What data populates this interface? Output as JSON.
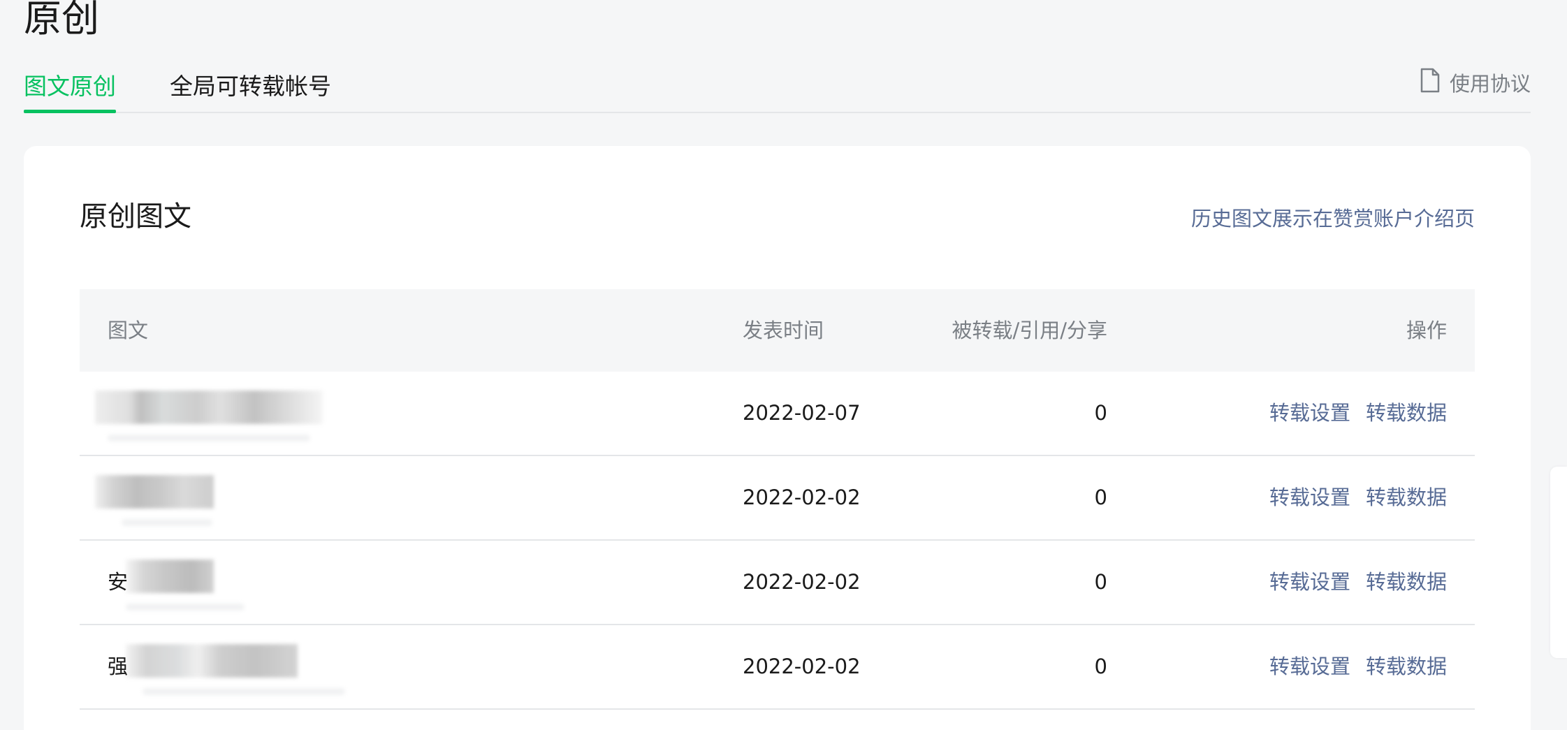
{
  "page": {
    "title": "原创"
  },
  "tabs": [
    {
      "label": "图文原创",
      "active": true
    },
    {
      "label": "全局可转载帐号",
      "active": false
    }
  ],
  "agreement": {
    "label": "使用协议",
    "icon": "document-icon"
  },
  "card": {
    "title": "原创图文",
    "link": "历史图文展示在赞赏账户介绍页"
  },
  "table": {
    "columns": [
      "图文",
      "发表时间",
      "被转载/引用/分享",
      "操作"
    ],
    "rows": [
      {
        "title": "",
        "date": "2022-02-07",
        "count": "0",
        "actions": [
          "转载设置",
          "转载数据"
        ]
      },
      {
        "title": "",
        "date": "2022-02-02",
        "count": "0",
        "actions": [
          "转载设置",
          "转载数据"
        ]
      },
      {
        "title": "安",
        "date": "2022-02-02",
        "count": "0",
        "actions": [
          "转载设置",
          "转载数据"
        ]
      },
      {
        "title": "强",
        "date": "2022-02-02",
        "count": "0",
        "actions": [
          "转载设置",
          "转载数据"
        ]
      }
    ]
  },
  "colors": {
    "accent": "#07c160",
    "link": "#576b95",
    "muted": "#7a7f85",
    "background": "#f5f6f7"
  }
}
